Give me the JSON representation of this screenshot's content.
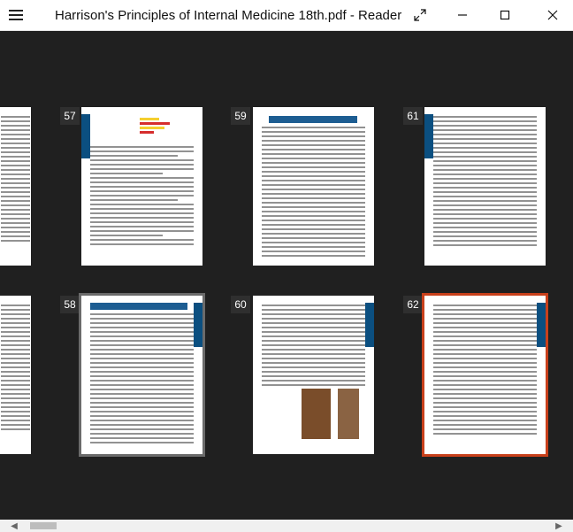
{
  "window": {
    "title": "Harrison's Principles of Internal Medicine 18th.pdf - Reader"
  },
  "toolbar": {
    "menu_icon": "hamburger-menu-icon",
    "fullscreen_icon": "expand-icon",
    "minimize_icon": "minimize-icon",
    "maximize_icon": "maximize-icon",
    "close_icon": "close-icon"
  },
  "pages": [
    {
      "number": "57"
    },
    {
      "number": "59"
    },
    {
      "number": "61"
    },
    {
      "number": "58"
    },
    {
      "number": "60"
    },
    {
      "number": "62"
    }
  ],
  "scrollbar": {
    "left_arrow": "◀",
    "right_arrow": "▶"
  },
  "colors": {
    "accent": "#c8401b",
    "background": "#202020",
    "page_blue": "#0b4f80"
  }
}
